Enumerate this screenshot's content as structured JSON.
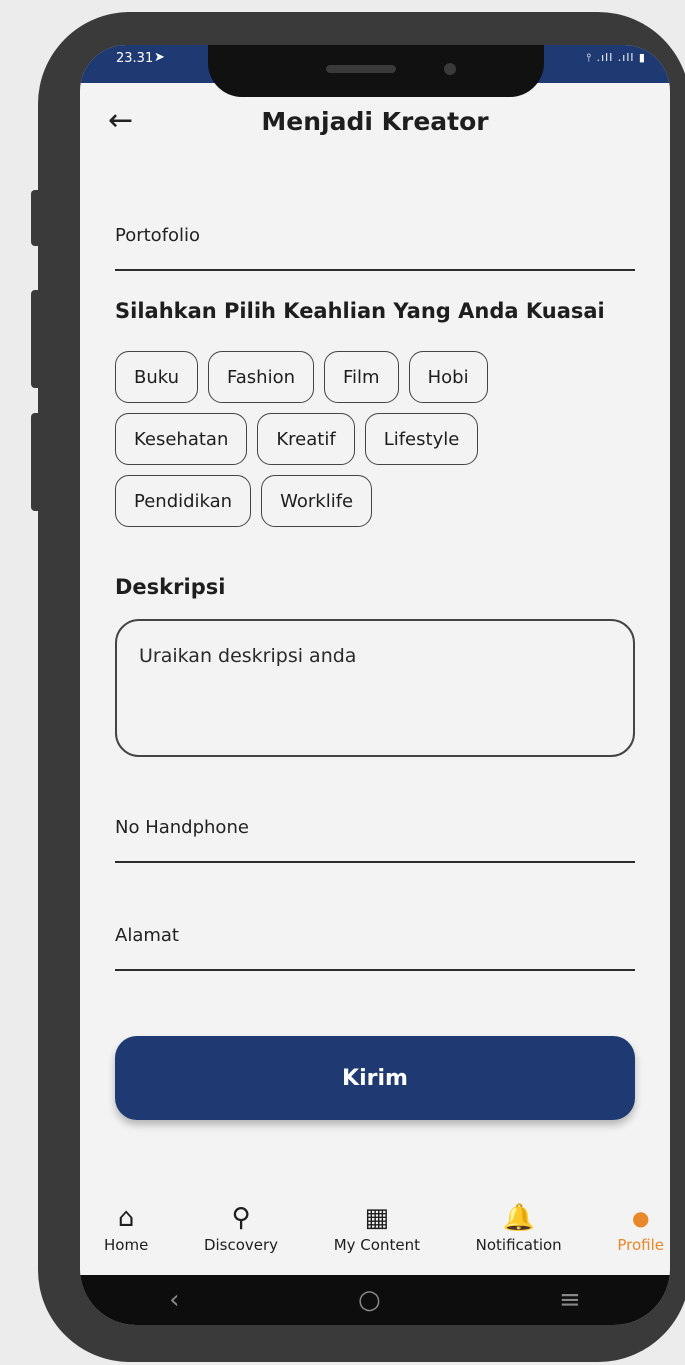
{
  "status_bar": {
    "time": "23.31",
    "signal": "⫯ .ıll .ıll ▮"
  },
  "header": {
    "title": "Menjadi Kreator"
  },
  "fields": {
    "portfolio_label": "Portofolio",
    "phone_label": "No Handphone",
    "address_label": "Alamat"
  },
  "skills": {
    "title": "Silahkan Pilih Keahlian Yang Anda Kuasai",
    "rows": [
      [
        "Buku",
        "Fashion",
        "Film",
        "Hobi"
      ],
      [
        "Kesehatan",
        "Kreatif",
        "Lifestyle"
      ],
      [
        "Pendidikan",
        "Worklife"
      ]
    ]
  },
  "description": {
    "title": "Deskripsi",
    "placeholder": "Uraikan deskripsi anda"
  },
  "submit": {
    "label": "Kirim"
  },
  "bottom_nav": [
    {
      "label": "Home",
      "icon": "home-icon",
      "active": false
    },
    {
      "label": "Discovery",
      "icon": "search-icon",
      "active": false
    },
    {
      "label": "My Content",
      "icon": "grid-icon",
      "active": false
    },
    {
      "label": "Notification",
      "icon": "bell-icon",
      "active": false
    },
    {
      "label": "Profile",
      "icon": "person-icon",
      "active": true
    }
  ],
  "colors": {
    "primary": "#1f3a73",
    "active_nav": "#e8882a",
    "background": "#f3f3f3"
  }
}
